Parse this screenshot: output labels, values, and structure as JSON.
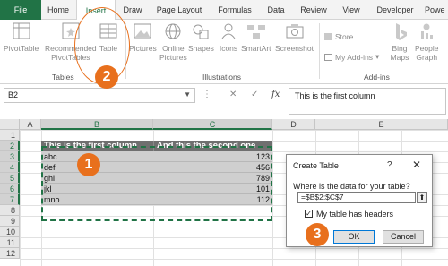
{
  "ribbon_tabs": [
    "File",
    "Home",
    "Insert",
    "Draw",
    "Page Layout",
    "Formulas",
    "Data",
    "Review",
    "View",
    "Developer",
    "Powe"
  ],
  "active_tab": "Insert",
  "tables_group": {
    "pivottable": "PivotTable",
    "recommended_line1": "Recommended",
    "recommended_line2": "PivotTables",
    "table": "Table",
    "label": "Tables"
  },
  "illustrations_group": {
    "pictures": "Pictures",
    "online_line1": "Online",
    "online_line2": "Pictures",
    "shapes": "Shapes",
    "icons": "Icons",
    "smartart": "SmartArt",
    "screenshot": "Screenshot",
    "label": "Illustrations"
  },
  "addins_group": {
    "store": "Store",
    "my_addins": "My Add-ins",
    "bing_line1": "Bing",
    "bing_line2": "Maps",
    "people_line1": "People",
    "people_line2": "Graph",
    "label": "Add-ins"
  },
  "formula_bar": {
    "name_box": "B2",
    "fx": "fx",
    "formula": "This is the first column"
  },
  "columns": [
    "A",
    "B",
    "C",
    "D",
    "E"
  ],
  "rows": [
    "1",
    "2",
    "3",
    "4",
    "5",
    "6",
    "7",
    "8",
    "9",
    "10",
    "11",
    "12"
  ],
  "table": {
    "headers": [
      "This is the first column",
      "And this the second one"
    ],
    "rows": [
      [
        "abc",
        "123"
      ],
      [
        "def",
        "456"
      ],
      [
        "ghi",
        "789"
      ],
      [
        "jkl",
        "101"
      ],
      [
        "mno",
        "112"
      ]
    ]
  },
  "dialog": {
    "title": "Create Table",
    "help": "?",
    "close": "✕",
    "prompt": "Where is the data for your table?",
    "range": "=$B$2:$C$7",
    "has_headers_label": "My table has headers",
    "has_headers_checked": "✓",
    "ok": "OK",
    "cancel": "Cancel"
  },
  "callouts": [
    "1",
    "2",
    "3"
  ],
  "colors": {
    "excel_green": "#217346",
    "callout_orange": "#e8701d",
    "header_fill": "#6f6f6f",
    "data_fill": "#cfcfcf"
  }
}
